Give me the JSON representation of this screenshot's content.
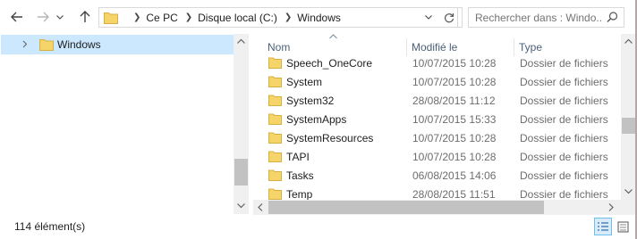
{
  "toolbar": {
    "back_icon": "back-arrow-icon",
    "forward_icon": "forward-arrow-icon",
    "recent_icon": "chevron-down-icon",
    "up_icon": "up-arrow-icon"
  },
  "address": {
    "crumbs": [
      "Ce PC",
      "Disque local (C:)",
      "Windows"
    ]
  },
  "search": {
    "placeholder": "Rechercher dans : Windo..."
  },
  "nav": {
    "items": [
      {
        "label": "Windows",
        "selected": true
      }
    ]
  },
  "columns": {
    "name": "Nom",
    "modified": "Modifié le",
    "type": "Type"
  },
  "rows": [
    {
      "name": "Speech_OneCore",
      "date": "10/07/2015 10:28",
      "type": "Dossier de fichiers"
    },
    {
      "name": "System",
      "date": "10/07/2015 10:28",
      "type": "Dossier de fichiers"
    },
    {
      "name": "System32",
      "date": "28/08/2015 11:12",
      "type": "Dossier de fichiers"
    },
    {
      "name": "SystemApps",
      "date": "10/07/2015 15:33",
      "type": "Dossier de fichiers"
    },
    {
      "name": "SystemResources",
      "date": "10/07/2015 10:28",
      "type": "Dossier de fichiers"
    },
    {
      "name": "TAPI",
      "date": "10/07/2015 10:28",
      "type": "Dossier de fichiers"
    },
    {
      "name": "Tasks",
      "date": "06/08/2015 14:06",
      "type": "Dossier de fichiers"
    },
    {
      "name": "Temp",
      "date": "28/08/2015 11:51",
      "type": "Dossier de fichiers"
    }
  ],
  "status": {
    "count": "114 élément(s)",
    "active_view": "details"
  },
  "colors": {
    "selection": "#cce8ff",
    "folder": "#f5d46a",
    "header_text": "#4c607a",
    "secondary_text": "#6d6d6d"
  }
}
